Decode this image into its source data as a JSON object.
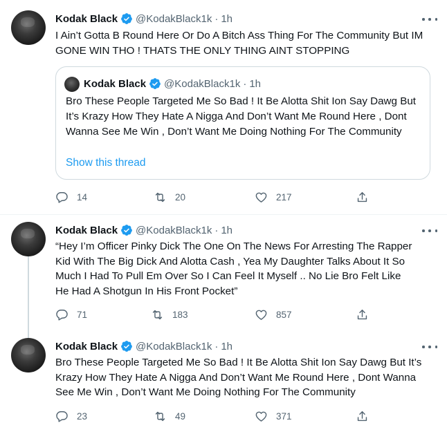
{
  "tweets": [
    {
      "name": "Kodak Black",
      "handle": "@KodakBlack1k",
      "time": "1h",
      "text": "I Ain’t Gotta B Round Here Or Do A Bitch Ass Thing For The Community But IM GONE WIN THO ! THATS THE ONLY THING AINT STOPPING",
      "quote": {
        "name": "Kodak Black",
        "handle": "@KodakBlack1k",
        "time": "1h",
        "text": "Bro These People Targeted Me So Bad ! It Be Alotta Shit Ion Say Dawg But It’s Krazy How They Hate A Nigga And Don’t Want Me Round Here , Dont Wanna See Me Win , Don’t Want Me Doing Nothing For The Community",
        "link": "Show this thread"
      },
      "replies": "14",
      "retweets": "20",
      "likes": "217"
    },
    {
      "name": "Kodak Black",
      "handle": "@KodakBlack1k",
      "time": "1h",
      "text": "“Hey I’m Officer Pinky Dick The One On The News For Arresting The Rapper Kid With The Big Dick And Alotta Cash , Yea My Daughter Talks About It So Much I Had To Pull Em Over So I Can Feel It Myself .. No Lie Bro Felt Like He Had A Shotgun In His Front Pocket”",
      "replies": "71",
      "retweets": "183",
      "likes": "857"
    },
    {
      "name": "Kodak Black",
      "handle": "@KodakBlack1k",
      "time": "1h",
      "text": "Bro These People Targeted Me So Bad ! It Be Alotta Shit Ion Say Dawg But It’s Krazy How They Hate A Nigga And Don’t Want Me Round Here , Dont Wanna See Me Win , Don’t Want Me Doing Nothing For The Community",
      "replies": "23",
      "retweets": "49",
      "likes": "371"
    }
  ],
  "separator": "·",
  "icons": {
    "verified": "verified-badge-icon",
    "more": "more-icon",
    "reply": "reply-icon",
    "retweet": "retweet-icon",
    "like": "heart-icon",
    "share": "share-icon"
  },
  "colors": {
    "accent": "#1d9bf0",
    "text": "#0f1419",
    "secondary": "#536471",
    "border": "#cfd9de"
  }
}
